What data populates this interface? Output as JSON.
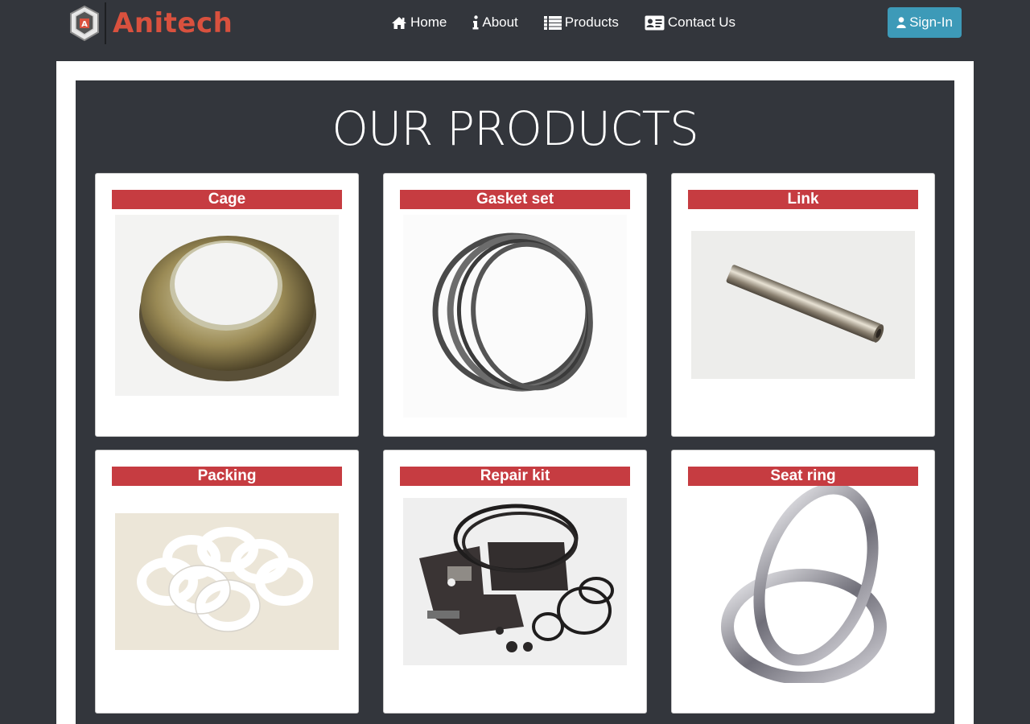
{
  "brand": {
    "name": "Anitech"
  },
  "nav": {
    "items": [
      {
        "label": "Home",
        "icon": "home-icon"
      },
      {
        "label": "About",
        "icon": "info-icon"
      },
      {
        "label": "Products",
        "icon": "list-icon"
      },
      {
        "label": "Contact Us",
        "icon": "contact-card-icon"
      }
    ],
    "signin_label": "Sign-In"
  },
  "page": {
    "heading": "OUR PRODUCTS"
  },
  "products": [
    {
      "name": "Cage"
    },
    {
      "name": "Gasket set"
    },
    {
      "name": "Link"
    },
    {
      "name": "Packing"
    },
    {
      "name": "Repair kit"
    },
    {
      "name": "Seat ring"
    }
  ],
  "colors": {
    "background": "#33363c",
    "title_bar": "#c63c41",
    "brand": "#d9513e",
    "signin": "#3d9ab8"
  }
}
